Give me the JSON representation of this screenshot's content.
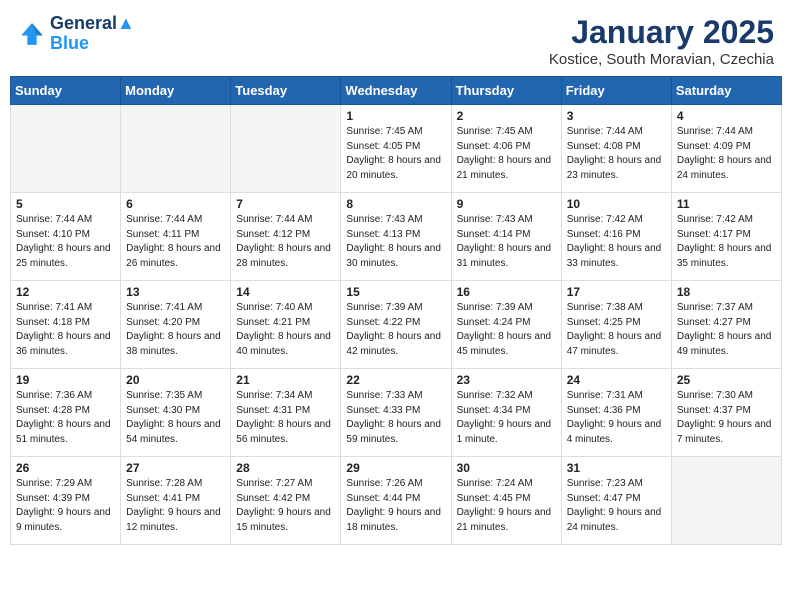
{
  "header": {
    "logo_line1": "General",
    "logo_line2": "Blue",
    "title": "January 2025",
    "subtitle": "Kostice, South Moravian, Czechia"
  },
  "days_of_week": [
    "Sunday",
    "Monday",
    "Tuesday",
    "Wednesday",
    "Thursday",
    "Friday",
    "Saturday"
  ],
  "weeks": [
    [
      {
        "day": "",
        "info": "",
        "empty": true
      },
      {
        "day": "",
        "info": "",
        "empty": true
      },
      {
        "day": "",
        "info": "",
        "empty": true
      },
      {
        "day": "1",
        "info": "Sunrise: 7:45 AM\nSunset: 4:05 PM\nDaylight: 8 hours\nand 20 minutes.",
        "empty": false
      },
      {
        "day": "2",
        "info": "Sunrise: 7:45 AM\nSunset: 4:06 PM\nDaylight: 8 hours\nand 21 minutes.",
        "empty": false
      },
      {
        "day": "3",
        "info": "Sunrise: 7:44 AM\nSunset: 4:08 PM\nDaylight: 8 hours\nand 23 minutes.",
        "empty": false
      },
      {
        "day": "4",
        "info": "Sunrise: 7:44 AM\nSunset: 4:09 PM\nDaylight: 8 hours\nand 24 minutes.",
        "empty": false
      }
    ],
    [
      {
        "day": "5",
        "info": "Sunrise: 7:44 AM\nSunset: 4:10 PM\nDaylight: 8 hours\nand 25 minutes.",
        "empty": false
      },
      {
        "day": "6",
        "info": "Sunrise: 7:44 AM\nSunset: 4:11 PM\nDaylight: 8 hours\nand 26 minutes.",
        "empty": false
      },
      {
        "day": "7",
        "info": "Sunrise: 7:44 AM\nSunset: 4:12 PM\nDaylight: 8 hours\nand 28 minutes.",
        "empty": false
      },
      {
        "day": "8",
        "info": "Sunrise: 7:43 AM\nSunset: 4:13 PM\nDaylight: 8 hours\nand 30 minutes.",
        "empty": false
      },
      {
        "day": "9",
        "info": "Sunrise: 7:43 AM\nSunset: 4:14 PM\nDaylight: 8 hours\nand 31 minutes.",
        "empty": false
      },
      {
        "day": "10",
        "info": "Sunrise: 7:42 AM\nSunset: 4:16 PM\nDaylight: 8 hours\nand 33 minutes.",
        "empty": false
      },
      {
        "day": "11",
        "info": "Sunrise: 7:42 AM\nSunset: 4:17 PM\nDaylight: 8 hours\nand 35 minutes.",
        "empty": false
      }
    ],
    [
      {
        "day": "12",
        "info": "Sunrise: 7:41 AM\nSunset: 4:18 PM\nDaylight: 8 hours\nand 36 minutes.",
        "empty": false
      },
      {
        "day": "13",
        "info": "Sunrise: 7:41 AM\nSunset: 4:20 PM\nDaylight: 8 hours\nand 38 minutes.",
        "empty": false
      },
      {
        "day": "14",
        "info": "Sunrise: 7:40 AM\nSunset: 4:21 PM\nDaylight: 8 hours\nand 40 minutes.",
        "empty": false
      },
      {
        "day": "15",
        "info": "Sunrise: 7:39 AM\nSunset: 4:22 PM\nDaylight: 8 hours\nand 42 minutes.",
        "empty": false
      },
      {
        "day": "16",
        "info": "Sunrise: 7:39 AM\nSunset: 4:24 PM\nDaylight: 8 hours\nand 45 minutes.",
        "empty": false
      },
      {
        "day": "17",
        "info": "Sunrise: 7:38 AM\nSunset: 4:25 PM\nDaylight: 8 hours\nand 47 minutes.",
        "empty": false
      },
      {
        "day": "18",
        "info": "Sunrise: 7:37 AM\nSunset: 4:27 PM\nDaylight: 8 hours\nand 49 minutes.",
        "empty": false
      }
    ],
    [
      {
        "day": "19",
        "info": "Sunrise: 7:36 AM\nSunset: 4:28 PM\nDaylight: 8 hours\nand 51 minutes.",
        "empty": false
      },
      {
        "day": "20",
        "info": "Sunrise: 7:35 AM\nSunset: 4:30 PM\nDaylight: 8 hours\nand 54 minutes.",
        "empty": false
      },
      {
        "day": "21",
        "info": "Sunrise: 7:34 AM\nSunset: 4:31 PM\nDaylight: 8 hours\nand 56 minutes.",
        "empty": false
      },
      {
        "day": "22",
        "info": "Sunrise: 7:33 AM\nSunset: 4:33 PM\nDaylight: 8 hours\nand 59 minutes.",
        "empty": false
      },
      {
        "day": "23",
        "info": "Sunrise: 7:32 AM\nSunset: 4:34 PM\nDaylight: 9 hours\nand 1 minute.",
        "empty": false
      },
      {
        "day": "24",
        "info": "Sunrise: 7:31 AM\nSunset: 4:36 PM\nDaylight: 9 hours\nand 4 minutes.",
        "empty": false
      },
      {
        "day": "25",
        "info": "Sunrise: 7:30 AM\nSunset: 4:37 PM\nDaylight: 9 hours\nand 7 minutes.",
        "empty": false
      }
    ],
    [
      {
        "day": "26",
        "info": "Sunrise: 7:29 AM\nSunset: 4:39 PM\nDaylight: 9 hours\nand 9 minutes.",
        "empty": false
      },
      {
        "day": "27",
        "info": "Sunrise: 7:28 AM\nSunset: 4:41 PM\nDaylight: 9 hours\nand 12 minutes.",
        "empty": false
      },
      {
        "day": "28",
        "info": "Sunrise: 7:27 AM\nSunset: 4:42 PM\nDaylight: 9 hours\nand 15 minutes.",
        "empty": false
      },
      {
        "day": "29",
        "info": "Sunrise: 7:26 AM\nSunset: 4:44 PM\nDaylight: 9 hours\nand 18 minutes.",
        "empty": false
      },
      {
        "day": "30",
        "info": "Sunrise: 7:24 AM\nSunset: 4:45 PM\nDaylight: 9 hours\nand 21 minutes.",
        "empty": false
      },
      {
        "day": "31",
        "info": "Sunrise: 7:23 AM\nSunset: 4:47 PM\nDaylight: 9 hours\nand 24 minutes.",
        "empty": false
      },
      {
        "day": "",
        "info": "",
        "empty": true
      }
    ]
  ]
}
